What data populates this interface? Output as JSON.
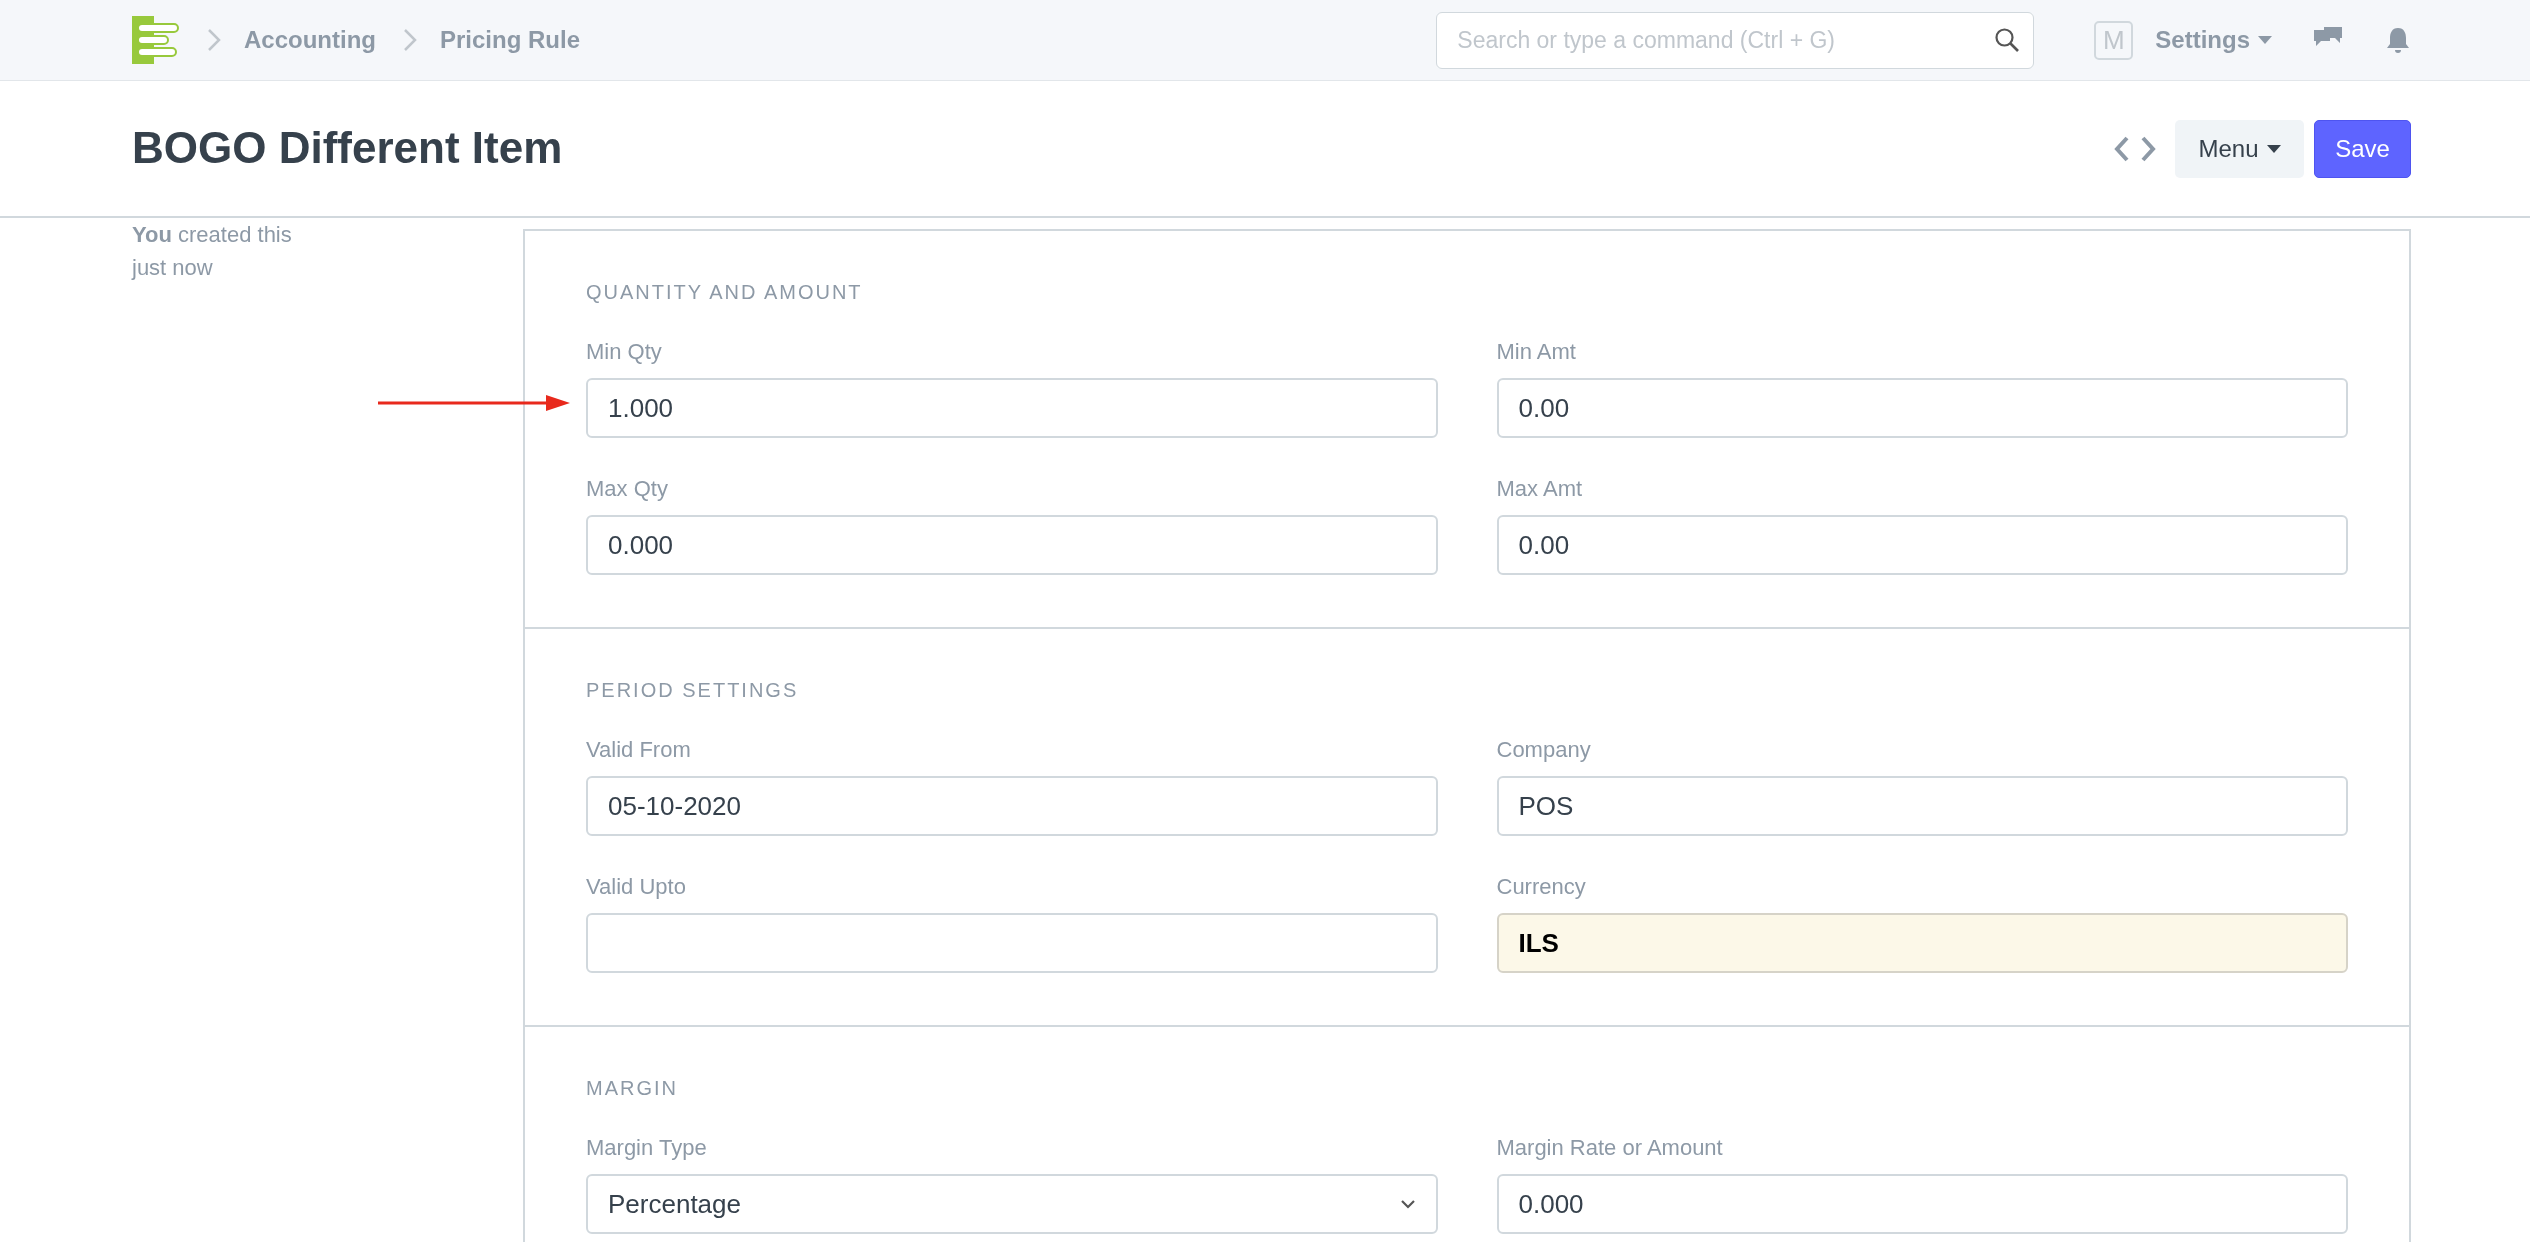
{
  "breadcrumbs": [
    {
      "label": "Accounting"
    },
    {
      "label": "Pricing Rule"
    }
  ],
  "search": {
    "placeholder": "Search or type a command (Ctrl + G)"
  },
  "user_initial": "M",
  "settings_menu": "Settings",
  "title": "BOGO Different Item",
  "menu_button": "Menu",
  "save_button": "Save",
  "activity": "**You** created this just now",
  "sections": [
    {
      "heading": "QUANTITY AND AMOUNT",
      "columns": [
        [
          {
            "label": "Min Qty",
            "value": "1.000",
            "kind": "text",
            "readonly": false
          },
          {
            "label": "Max Qty",
            "value": "0.000",
            "kind": "text",
            "readonly": false
          }
        ],
        [
          {
            "label": "Min Amt",
            "value": "0.00",
            "kind": "text",
            "readonly": false
          },
          {
            "label": "Max Amt",
            "value": "0.00",
            "kind": "text",
            "readonly": false
          }
        ]
      ]
    },
    {
      "heading": "PERIOD SETTINGS",
      "columns": [
        [
          {
            "label": "Valid From",
            "value": "05-10-2020",
            "kind": "text",
            "readonly": false
          },
          {
            "label": "Valid Upto",
            "kind": "text",
            "readonly": false
          }
        ],
        [
          {
            "label": "Company",
            "value": "POS",
            "kind": "text",
            "readonly": false
          },
          {
            "label": "Currency",
            "value": "ILS",
            "kind": "text",
            "readonly": true
          }
        ]
      ]
    },
    {
      "heading": "MARGIN",
      "columns": [
        [
          {
            "label": "Margin Type",
            "value": "Percentage",
            "kind": "select",
            "readonly": false
          }
        ],
        [
          {
            "label": "Margin Rate or Amount",
            "value": "0.000",
            "kind": "text",
            "readonly": false
          }
        ]
      ]
    }
  ]
}
